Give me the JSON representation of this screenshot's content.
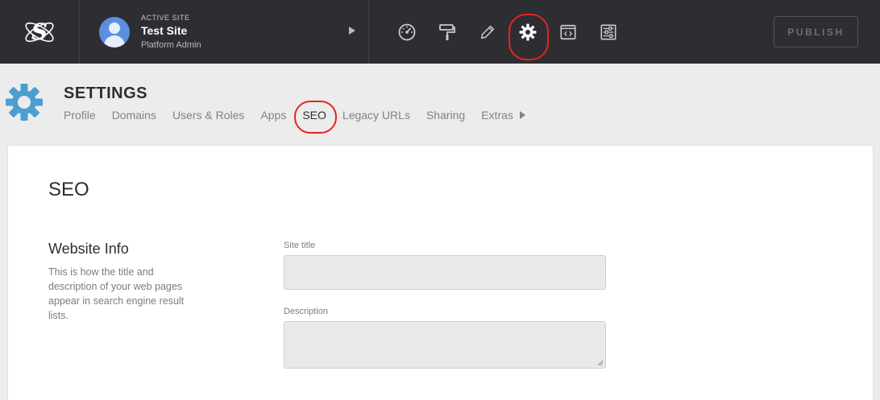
{
  "topbar": {
    "logo_icon": "atom-s-logo-icon",
    "site": {
      "kicker": "ACTIVE SITE",
      "name": "Test Site",
      "role": "Platform Admin"
    },
    "tools": [
      {
        "icon": "dashboard-gauge-icon"
      },
      {
        "icon": "paint-roller-icon"
      },
      {
        "icon": "pencil-icon"
      },
      {
        "icon": "gear-icon",
        "active": true
      },
      {
        "icon": "code-window-icon"
      },
      {
        "icon": "sliders-icon"
      }
    ],
    "publish_label": "PUBLISH"
  },
  "settings": {
    "title": "SETTINGS",
    "tabs": [
      {
        "label": "Profile"
      },
      {
        "label": "Domains"
      },
      {
        "label": "Users & Roles"
      },
      {
        "label": "Apps"
      },
      {
        "label": "SEO",
        "active": true
      },
      {
        "label": "Legacy URLs"
      },
      {
        "label": "Sharing"
      },
      {
        "label": "Extras"
      }
    ]
  },
  "content": {
    "title": "SEO",
    "section": {
      "title": "Website Info",
      "description": "This is how the title and description of your web pages appear in search engine result lists."
    },
    "fields": {
      "site_title": {
        "label": "Site title",
        "value": ""
      },
      "description": {
        "label": "Description",
        "value": ""
      }
    }
  },
  "colors": {
    "topbar_bg": "#2d2e32",
    "accent_gear": "#4a9fd0",
    "highlight_ring": "#e8231c"
  }
}
